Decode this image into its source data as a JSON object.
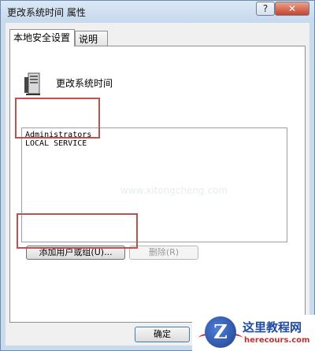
{
  "window": {
    "title": "更改系统时间 属性",
    "help_label": "?",
    "close_label": "✕"
  },
  "tabs": [
    {
      "label": "本地安全设置"
    },
    {
      "label": "说明"
    }
  ],
  "policy": {
    "icon": "server-icon",
    "name": "更改系统时间"
  },
  "accounts": {
    "items": [
      "Administrators",
      "LOCAL SERVICE"
    ],
    "watermark": "www.xitongcheng.com"
  },
  "buttons": {
    "add": "添加用户或组(U)...",
    "remove": "删除(R)",
    "ok": "确定",
    "cancel": ""
  },
  "logo": {
    "brand": "这里教程网",
    "url": "herecours.com"
  },
  "colors": {
    "highlight": "#c0504d",
    "window_frame": "#c9daeb",
    "close_button": "#c7432b"
  }
}
